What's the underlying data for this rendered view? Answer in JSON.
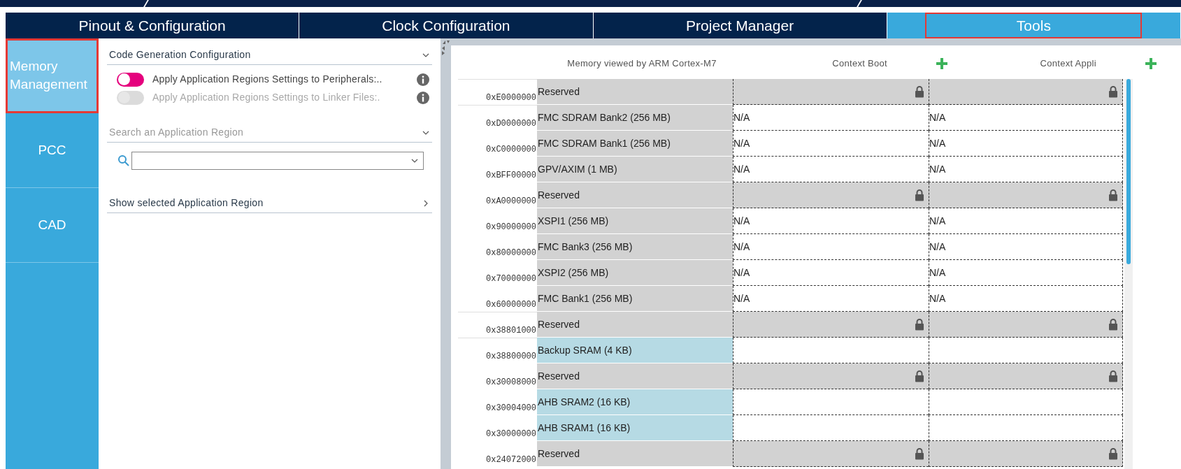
{
  "tabs": [
    {
      "label": "Pinout & Configuration",
      "selected": false
    },
    {
      "label": "Clock Configuration",
      "selected": false
    },
    {
      "label": "Project Manager",
      "selected": false
    },
    {
      "label": "Tools",
      "selected": true
    }
  ],
  "sidebar": {
    "items": [
      {
        "label": "Memory Management",
        "selected": true
      },
      {
        "label": "PCC",
        "selected": false
      },
      {
        "label": "CAD",
        "selected": false
      }
    ]
  },
  "code_generation": {
    "title": "Code Generation Configuration",
    "expanded": true,
    "toggles": [
      {
        "label": "Apply Application Regions Settings to Peripherals:..",
        "on": false,
        "disabled": false
      },
      {
        "label": "Apply Application Regions Settings to Linker Files:.",
        "on": false,
        "disabled": true
      }
    ]
  },
  "search_section": {
    "title": "Search an Application Region",
    "expanded": true
  },
  "show_selected": {
    "title": "Show selected Application Region",
    "expanded": false
  },
  "memory_table": {
    "columns": [
      "Memory viewed by ARM Cortex-M7",
      "Context Boot",
      "Context Appli"
    ],
    "rows": [
      {
        "address": "0xE0000000",
        "region": "Reserved",
        "kind": "reserved"
      },
      {
        "address": "0xD0000000",
        "region": "FMC SDRAM Bank2 (256 MB)",
        "kind": "external",
        "boot": "N/A",
        "appli": "N/A"
      },
      {
        "address": "0xC0000000",
        "region": "FMC SDRAM Bank1 (256 MB)",
        "kind": "external",
        "boot": "N/A",
        "appli": "N/A"
      },
      {
        "address": "0xBFF00000",
        "region": "GPV/AXIM (1 MB)",
        "kind": "external",
        "boot": "N/A",
        "appli": "N/A"
      },
      {
        "address": "0xA0000000",
        "region": "Reserved",
        "kind": "reserved"
      },
      {
        "address": "0x90000000",
        "region": "XSPI1 (256 MB)",
        "kind": "external",
        "boot": "N/A",
        "appli": "N/A"
      },
      {
        "address": "0x80000000",
        "region": "FMC Bank3 (256 MB)",
        "kind": "external",
        "boot": "N/A",
        "appli": "N/A"
      },
      {
        "address": "0x70000000",
        "region": "XSPI2 (256 MB)",
        "kind": "external",
        "boot": "N/A",
        "appli": "N/A"
      },
      {
        "address": "0x60000000",
        "region": "FMC Bank1 (256 MB)",
        "kind": "external",
        "boot": "N/A",
        "appli": "N/A"
      },
      {
        "address": "0x38801000",
        "region": "Reserved",
        "kind": "reserved"
      },
      {
        "address": "0x38800000",
        "region": "Backup SRAM (4 KB)",
        "kind": "internal"
      },
      {
        "address": "0x30008000",
        "region": "Reserved",
        "kind": "reserved"
      },
      {
        "address": "0x30004000",
        "region": "AHB SRAM2 (16 KB)",
        "kind": "internal"
      },
      {
        "address": "0x30000000",
        "region": "AHB SRAM1 (16 KB)",
        "kind": "internal"
      },
      {
        "address": "0x24072000",
        "region": "Reserved",
        "kind": "reserved"
      }
    ]
  }
}
